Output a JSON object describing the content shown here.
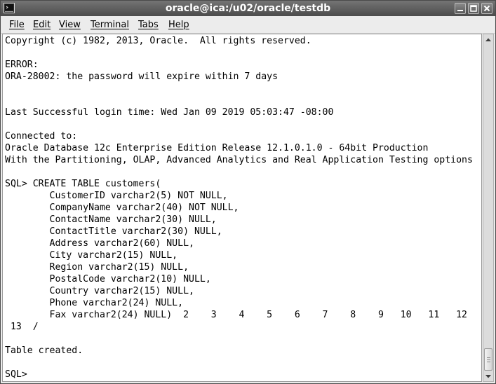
{
  "window": {
    "title": "oracle@ica:/u02/oracle/testdb",
    "controls": [
      "minimize-icon",
      "maximize-icon",
      "close-icon"
    ]
  },
  "menu": [
    {
      "label": "File"
    },
    {
      "label": "Edit"
    },
    {
      "label": "View"
    },
    {
      "label": "Terminal"
    },
    {
      "label": "Tabs"
    },
    {
      "label": "Help"
    }
  ],
  "terminal": {
    "lines": [
      "Copyright (c) 1982, 2013, Oracle.  All rights reserved.",
      "",
      "ERROR:",
      "ORA-28002: the password will expire within 7 days",
      "",
      "",
      "Last Successful login time: Wed Jan 09 2019 05:03:47 -08:00",
      "",
      "Connected to:",
      "Oracle Database 12c Enterprise Edition Release 12.1.0.1.0 - 64bit Production",
      "With the Partitioning, OLAP, Advanced Analytics and Real Application Testing options",
      "",
      "SQL> CREATE TABLE customers(",
      "        CustomerID varchar2(5) NOT NULL,",
      "        CompanyName varchar2(40) NOT NULL,",
      "        ContactName varchar2(30) NULL,",
      "        ContactTitle varchar2(30) NULL,",
      "        Address varchar2(60) NULL,",
      "        City varchar2(15) NULL,",
      "        Region varchar2(15) NULL,",
      "        PostalCode varchar2(10) NULL,",
      "        Country varchar2(15) NULL,",
      "        Phone varchar2(24) NULL,",
      "        Fax varchar2(24) NULL)  2    3    4    5    6    7    8    9   10   11   12",
      " 13  /",
      "",
      "Table created.",
      "",
      "SQL> "
    ]
  },
  "colors": {
    "terminal_bg": "#ffffff",
    "terminal_fg": "#000000",
    "titlebar_bg": "#5e5e5e"
  }
}
